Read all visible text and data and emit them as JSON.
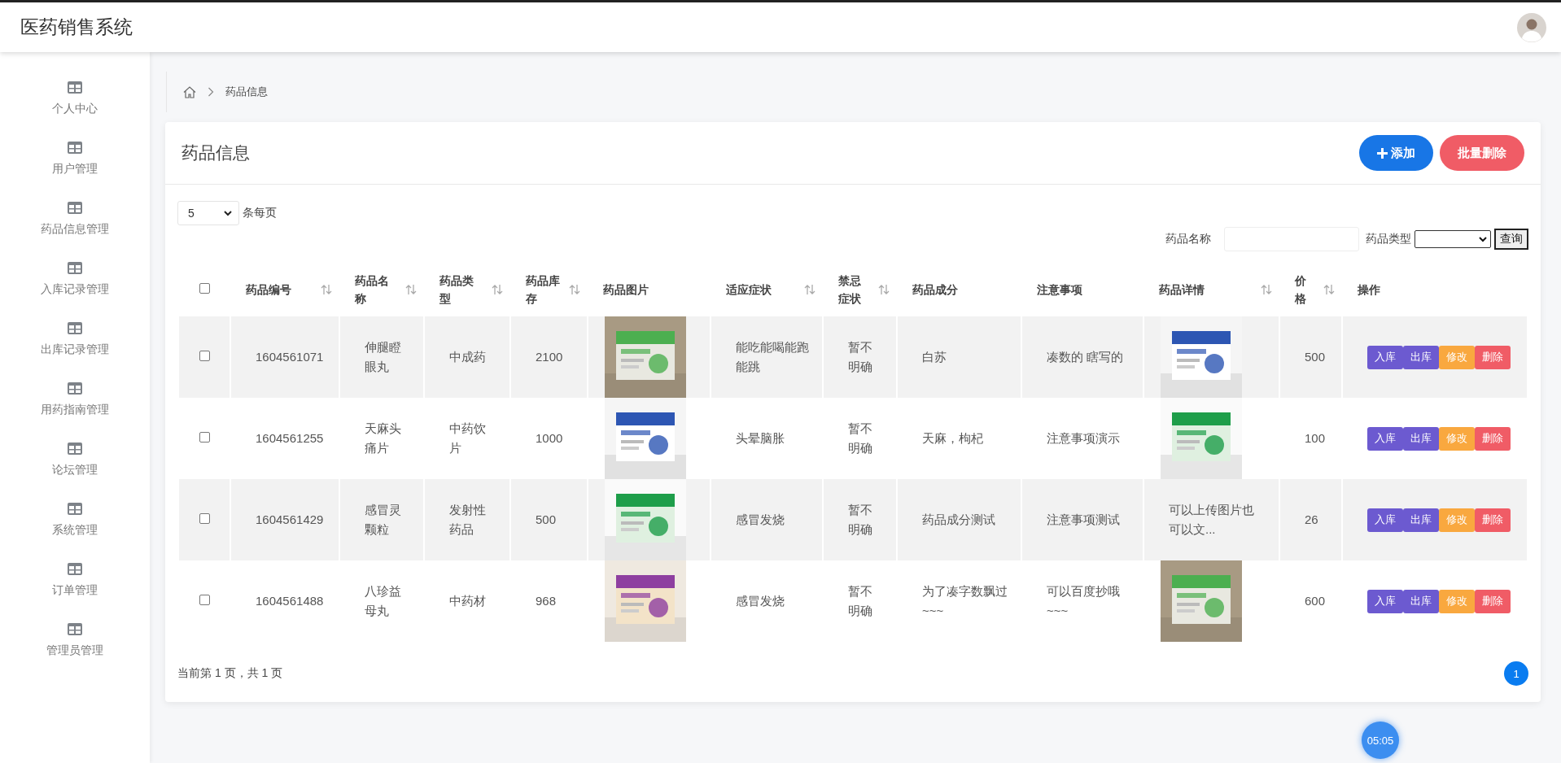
{
  "header": {
    "title": "医药销售系统"
  },
  "sidebar": {
    "items": [
      {
        "label": "个人中心"
      },
      {
        "label": "用户管理"
      },
      {
        "label": "药品信息管理"
      },
      {
        "label": "入库记录管理"
      },
      {
        "label": "出库记录管理"
      },
      {
        "label": "用药指南管理"
      },
      {
        "label": "论坛管理"
      },
      {
        "label": "系统管理"
      },
      {
        "label": "订单管理"
      },
      {
        "label": "管理员管理"
      }
    ]
  },
  "breadcrumb": {
    "items": [
      "药品信息"
    ]
  },
  "panel": {
    "title": "药品信息",
    "buttons": [
      {
        "label": "添加",
        "kind": "add"
      },
      {
        "label": "批量删除",
        "kind": "delete"
      }
    ]
  },
  "page_size": {
    "value": "5",
    "label": "条每页"
  },
  "search": {
    "fields": [
      {
        "label": "药品名称",
        "kind": "text"
      },
      {
        "label": "药品类型",
        "kind": "select"
      }
    ],
    "button": "查询"
  },
  "table": {
    "columns": [
      {
        "kind": "checkbox",
        "checked": false
      },
      {
        "kind": "text",
        "label": "药品编号",
        "sortable": true
      },
      {
        "kind": "text",
        "label": "药品名称",
        "sortable": true
      },
      {
        "kind": "text",
        "label": "药品类型",
        "sortable": true
      },
      {
        "kind": "text",
        "label": "药品库存",
        "sortable": true
      },
      {
        "kind": "text",
        "label": "药品图片",
        "sortable": false
      },
      {
        "kind": "text",
        "label": "适应症状",
        "sortable": true
      },
      {
        "kind": "text",
        "label": "禁忌症状",
        "sortable": true
      },
      {
        "kind": "text",
        "label": "药品成分",
        "sortable": false
      },
      {
        "kind": "text",
        "label": "注意事项",
        "sortable": false
      },
      {
        "kind": "text",
        "label": "药品详情",
        "sortable": true
      },
      {
        "kind": "text",
        "label": "价格",
        "sortable": true
      },
      {
        "kind": "text",
        "label": "操作",
        "sortable": false
      }
    ],
    "rows": [
      {
        "checked": false,
        "id": "1604561071",
        "name": "伸腿瞪眼丸",
        "type": "中成药",
        "stock": "2100",
        "symptoms": "能吃能喝能跑能跳",
        "contraindication": "暂不明确",
        "ingredients": "白苏",
        "notes": "凑数的 瞎写的",
        "price": "500",
        "actions": [
          {
            "label": "入库",
            "kind": "in"
          },
          {
            "label": "出库",
            "kind": "out"
          },
          {
            "label": "修改",
            "kind": "edit"
          },
          {
            "label": "删除",
            "kind": "delete"
          }
        ]
      },
      {
        "checked": false,
        "id": "1604561255",
        "name": "天麻头痛片",
        "type": "中药饮片",
        "stock": "1000",
        "symptoms": "头晕脑胀",
        "contraindication": "暂不明确",
        "ingredients": "天麻，枸杞",
        "notes": "注意事项演示",
        "price": "100",
        "actions": [
          {
            "label": "入库",
            "kind": "in"
          },
          {
            "label": "出库",
            "kind": "out"
          },
          {
            "label": "修改",
            "kind": "edit"
          },
          {
            "label": "删除",
            "kind": "delete"
          }
        ]
      },
      {
        "checked": false,
        "id": "1604561429",
        "name": "感冒灵颗粒",
        "type": "发射性药品",
        "stock": "500",
        "symptoms": "感冒发烧",
        "contraindication": "暂不明确",
        "ingredients": "药品成分测试",
        "notes": "注意事项测试",
        "detail": {
          "kind": "text",
          "text": "可以上传图片也可以文..."
        },
        "price": "26",
        "actions": [
          {
            "label": "入库",
            "kind": "in"
          },
          {
            "label": "出库",
            "kind": "out"
          },
          {
            "label": "修改",
            "kind": "edit"
          },
          {
            "label": "删除",
            "kind": "delete"
          }
        ]
      },
      {
        "checked": false,
        "id": "1604561488",
        "name": "八珍益母丸",
        "type": "中药材",
        "stock": "968",
        "symptoms": "感冒发烧",
        "contraindication": "暂不明确",
        "ingredients": "为了凑字数飘过~~~",
        "notes": "可以百度抄哦~~~",
        "price": "600",
        "actions": [
          {
            "label": "入库",
            "kind": "in"
          },
          {
            "label": "出库",
            "kind": "out"
          },
          {
            "label": "修改",
            "kind": "edit"
          },
          {
            "label": "删除",
            "kind": "delete"
          }
        ]
      }
    ]
  },
  "footer": {
    "page_info": "当前第 1 页，共 1 页",
    "pages": [
      {
        "label": "1",
        "selected": true
      }
    ]
  },
  "timer": {
    "text": "05:05"
  }
}
